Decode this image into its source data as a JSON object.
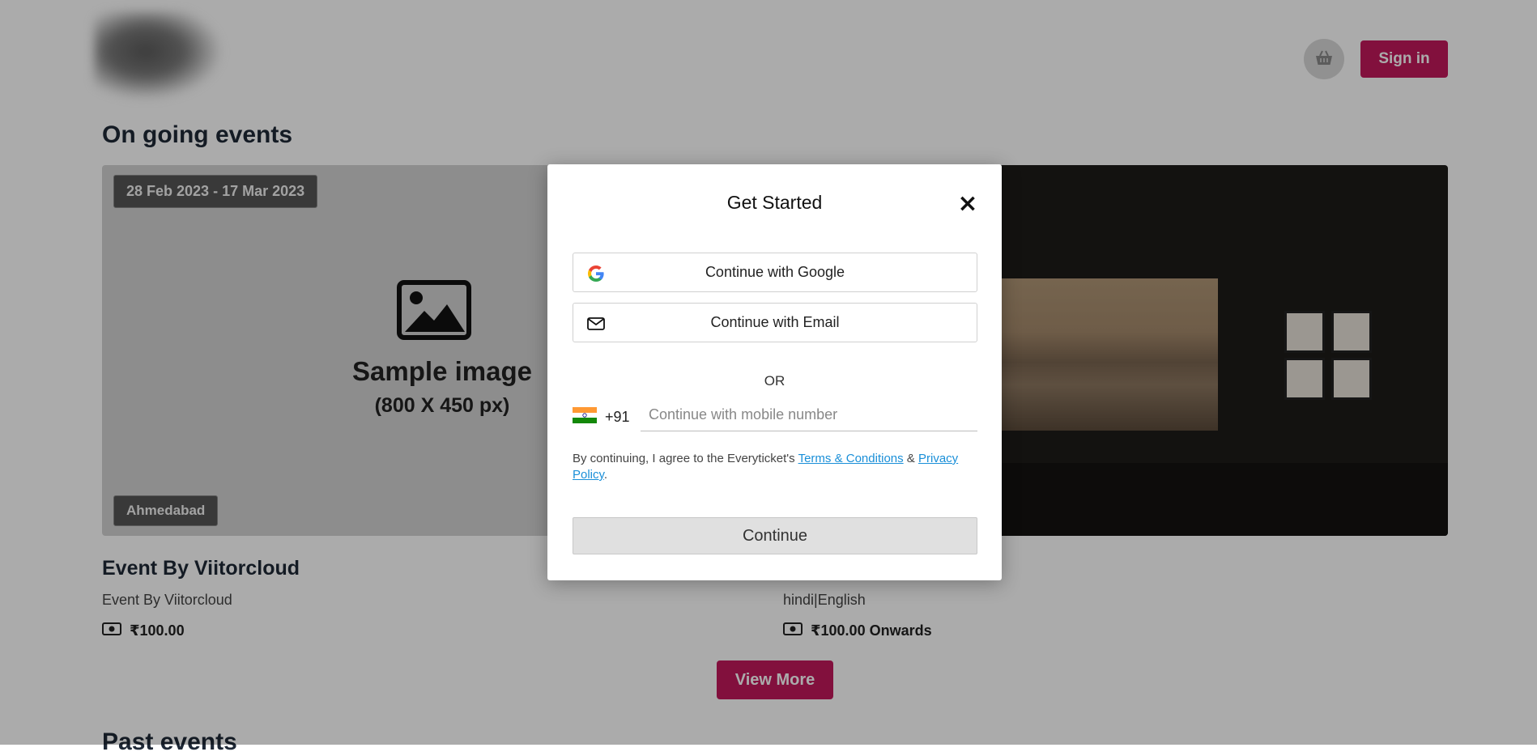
{
  "header": {
    "signin_label": "Sign in"
  },
  "ongoing": {
    "title": "On going events",
    "events": [
      {
        "date_range": "28 Feb 2023  -  17 Mar 2023",
        "city": "Ahmedabad",
        "image_title": "Sample image",
        "image_sub": "(800 X 450 px)",
        "name": "Event By Viitorcloud",
        "subtitle": "Event By Viitorcloud",
        "price": "₹100.00"
      },
      {
        "subtitle": "hindi|English",
        "price": "₹100.00 Onwards"
      }
    ],
    "view_more_label": "View More"
  },
  "past": {
    "title": "Past events"
  },
  "modal": {
    "title": "Get Started",
    "google_label": "Continue with Google",
    "email_label": "Continue with Email",
    "or_label": "OR",
    "country_code": "+91",
    "phone_placeholder": "Continue with mobile number",
    "terms_prefix": "By continuing, I agree to the Everyticket's ",
    "terms_link": "Terms & Conditions",
    "terms_and": " & ",
    "privacy_link": "Privacy Policy",
    "terms_suffix": ".",
    "continue_label": "Continue"
  },
  "colors": {
    "brand": "#c2185b",
    "link": "#1a8fd8",
    "overlay": "rgba(0,0,0,0.33)"
  }
}
